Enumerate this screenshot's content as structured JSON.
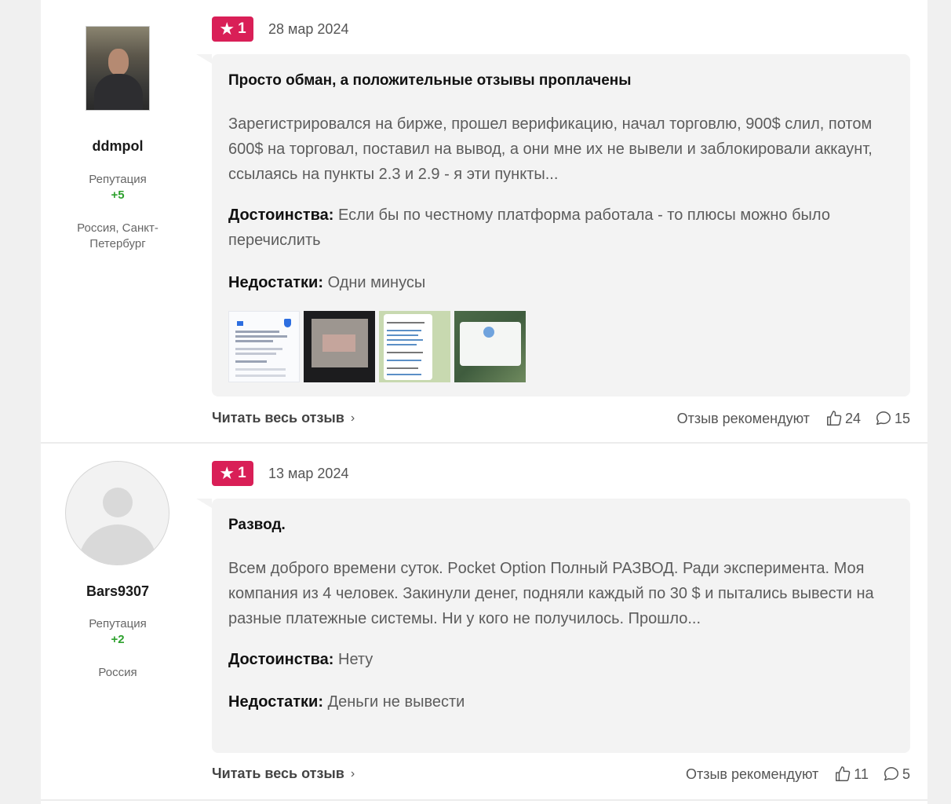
{
  "reviews": [
    {
      "author": {
        "username": "ddmpol",
        "reputation_label": "Репутация",
        "reputation_value": "+5",
        "location": "Россия, Санкт-Петербург"
      },
      "rating": "1",
      "date": "28 мар 2024",
      "title": "Просто обман, а положительные отзывы проплачены",
      "text": "Зарегистрировался на бирже, прошел верификацию, начал торговлю, 900$ слил, потом 600$ на торговал, поставил на вывод, а они мне их не вывели и заблокировали аккаунт, ссылаясь на пункты 2.3 и 2.9 - я эти пункты...",
      "pros_label": "Достоинства:",
      "pros": "Если бы по честному платформа работала - то плюсы можно было перечислить",
      "cons_label": "Недостатки:",
      "cons": "Одни минусы",
      "read_more": "Читать весь отзыв",
      "recommend_label": "Отзыв рекомендуют",
      "likes": "24",
      "comments": "15"
    },
    {
      "author": {
        "username": "Bars9307",
        "reputation_label": "Репутация",
        "reputation_value": "+2",
        "location": "Россия"
      },
      "rating": "1",
      "date": "13 мар 2024",
      "title": "Развод.",
      "text": "Всем доброго времени суток. Pocket Option Полный РАЗВОД. Ради эксперимента. Моя компания из 4 человек. Закинули денег, подняли каждый по 30 $ и пытались вывести на разные платежные системы. Ни у кого не получилось. Прошло...",
      "pros_label": "Достоинства:",
      "pros": "Нету",
      "cons_label": "Недостатки:",
      "cons": "Деньги не вывести",
      "read_more": "Читать весь отзыв",
      "recommend_label": "Отзыв рекомендуют",
      "likes": "11",
      "comments": "5"
    }
  ],
  "colors": {
    "rating_badge": "#d91f57",
    "reputation": "#2ea12e",
    "bubble_bg": "#f3f3f3"
  },
  "icons": {
    "rating": "star-icon",
    "likes": "thumbs-up-icon",
    "comments": "comment-icon",
    "read_more": "chevron-right-icon"
  }
}
